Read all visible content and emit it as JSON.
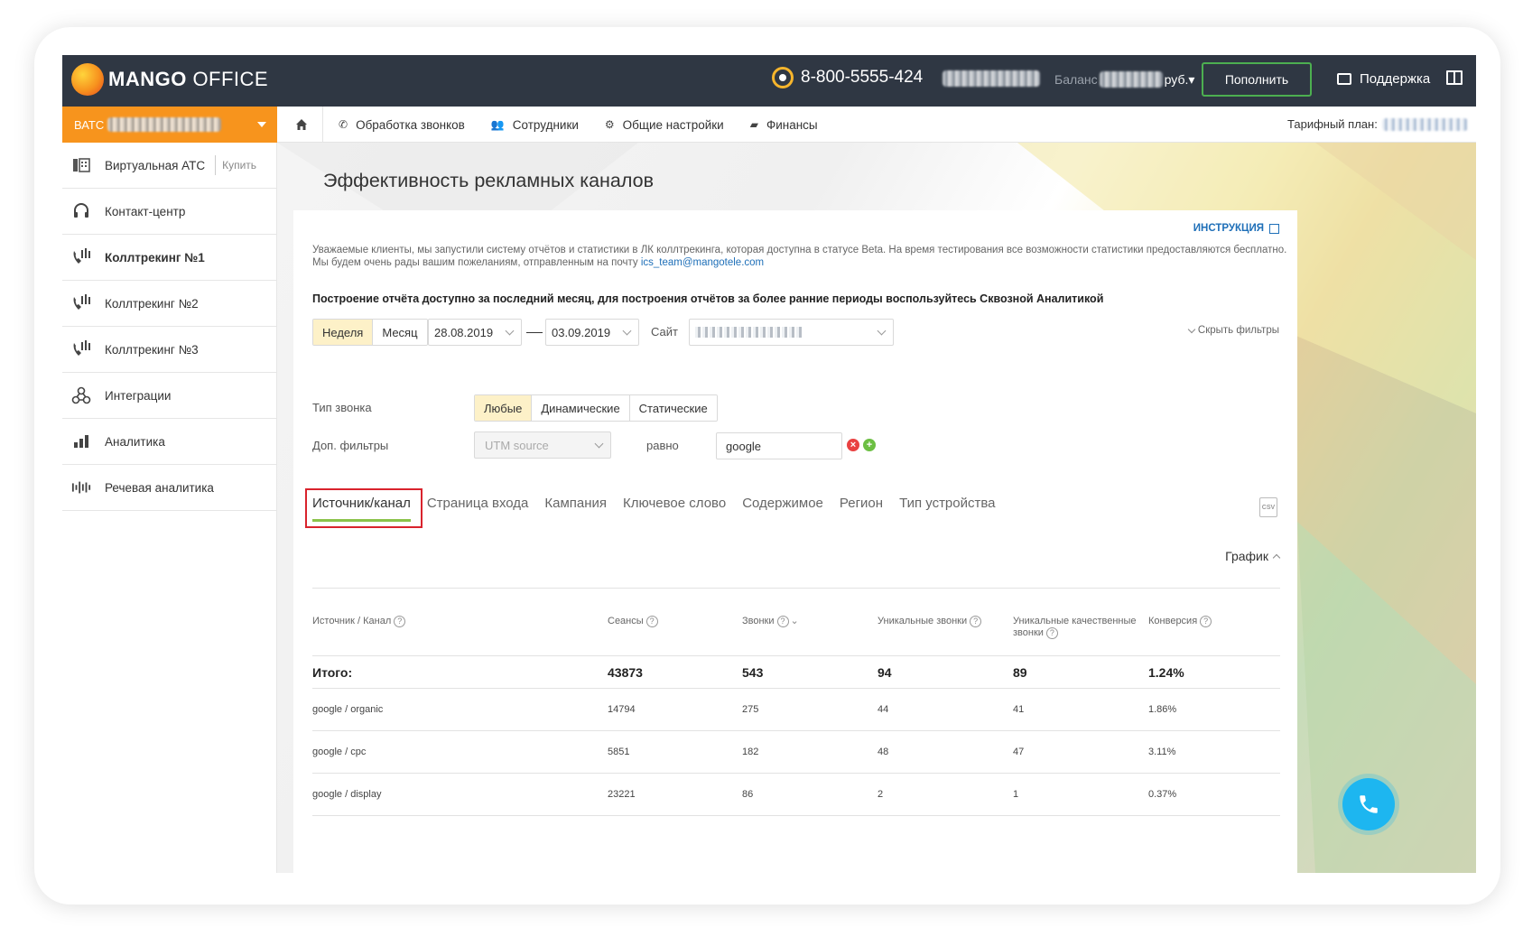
{
  "topbar": {
    "logo_bold": "MANGO",
    "logo_light": " OFFICE",
    "phone": "8-800-5555-424",
    "balance_label": "Баланс",
    "balance_value": "руб.",
    "topup_label": "Пополнить",
    "support_label": "Поддержка"
  },
  "navbar": {
    "ats_prefix": "ВАТС",
    "items": [
      {
        "label": "Обработка звонков",
        "icon": "phone-icon"
      },
      {
        "label": "Сотрудники",
        "icon": "users-icon"
      },
      {
        "label": "Общие настройки",
        "icon": "gear-icon"
      },
      {
        "label": "Финансы",
        "icon": "wallet-icon"
      }
    ],
    "tariff_label": "Тарифный план:"
  },
  "sidebar": {
    "items": [
      {
        "label": "Виртуальная АТС",
        "extra": "Купить"
      },
      {
        "label": "Контакт-центр"
      },
      {
        "label": "Коллтрекинг №1"
      },
      {
        "label": "Коллтрекинг №2"
      },
      {
        "label": "Коллтрекинг №3"
      },
      {
        "label": "Интеграции"
      },
      {
        "label": "Аналитика"
      },
      {
        "label": "Речевая аналитика"
      }
    ]
  },
  "page": {
    "title": "Эффективность рекламных каналов",
    "instructions": "ИНСТРУКЦИЯ",
    "notice_text": "Уважаемые клиенты, мы запустили систему отчётов и статистики в ЛК коллтрекинга, которая доступна в статусе Beta. На время тестирования все возможности статистики предоставляются бесплатно. Мы будем очень рады вашим пожеланиям, отправленным на почту ",
    "notice_email": "ics_team@mangotele.com",
    "report_note": "Построение отчёта доступно за последний месяц, для построения отчётов за более ранние периоды воспользуйтесь Сквозной Аналитикой"
  },
  "filters": {
    "period_week": "Неделя",
    "period_month": "Месяц",
    "date_from": "28.08.2019",
    "date_to": "03.09.2019",
    "site_label": "Сайт",
    "hide_filters": "Скрыть фильтры",
    "call_type_label": "Тип звонка",
    "call_types": [
      "Любые",
      "Динамические",
      "Статические"
    ],
    "extra_filters_label": "Доп. фильтры",
    "utm_placeholder": "UTM source",
    "equals_label": "равно",
    "filter_value": "google"
  },
  "tabs": [
    "Источник/канал",
    "Страница входа",
    "Кампания",
    "Ключевое слово",
    "Содержимое",
    "Регион",
    "Тип устройства"
  ],
  "graph_label": "График",
  "table": {
    "headers": [
      "Источник / Канал",
      "Сеансы",
      "Звонки",
      "Уникальные звонки",
      "Уникальные качественные звонки",
      "Конверсия"
    ],
    "total": [
      "Итого:",
      "43873",
      "543",
      "94",
      "89",
      "1.24%"
    ],
    "rows": [
      [
        "google / organic",
        "14794",
        "275",
        "44",
        "41",
        "1.86%"
      ],
      [
        "google / cpc",
        "5851",
        "182",
        "48",
        "47",
        "3.11%"
      ],
      [
        "google / display",
        "23221",
        "86",
        "2",
        "1",
        "0.37%"
      ]
    ]
  }
}
